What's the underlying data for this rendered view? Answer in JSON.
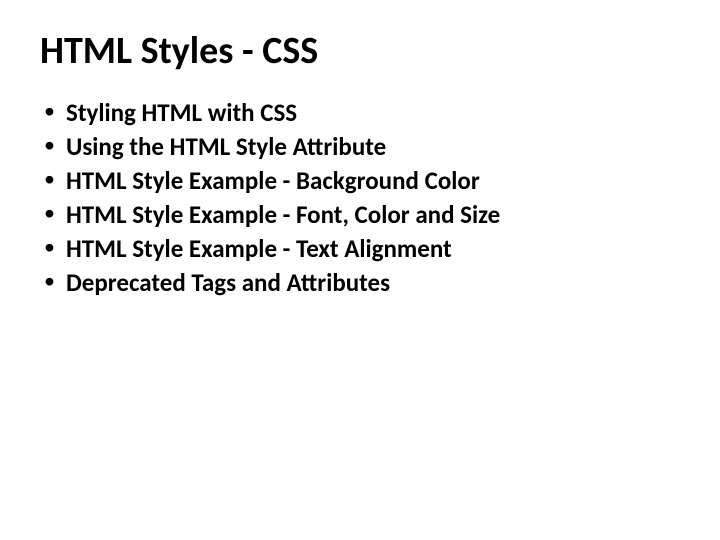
{
  "title": "HTML Styles - CSS",
  "bullets": [
    "Styling HTML with CSS",
    "Using the HTML Style Attribute",
    "HTML Style Example - Background Color",
    "HTML Style Example - Font, Color and Size",
    "HTML Style Example - Text Alignment",
    "Deprecated Tags and Attributes"
  ]
}
